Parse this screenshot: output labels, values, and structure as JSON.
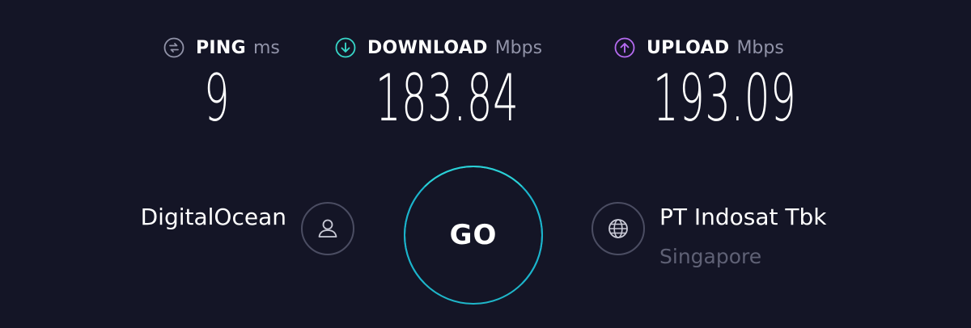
{
  "metrics": {
    "ping": {
      "label": "PING",
      "unit": "ms",
      "value": "9",
      "icon": "ping-icon",
      "color": "#9193a8"
    },
    "download": {
      "label": "DOWNLOAD",
      "unit": "Mbps",
      "value": "183.84",
      "icon": "download-arrow-icon",
      "color": "#37d6c8"
    },
    "upload": {
      "label": "UPLOAD",
      "unit": "Mbps",
      "value": "193.09",
      "icon": "upload-arrow-icon",
      "color": "#b56bf0"
    }
  },
  "provider": {
    "name": "DigitalOcean",
    "icon": "user-icon"
  },
  "go_button": {
    "label": "GO",
    "ring_color": "#1fb6c9"
  },
  "server": {
    "name": "PT Indosat Tbk",
    "location": "Singapore",
    "icon": "globe-icon"
  },
  "colors": {
    "background": "#141526",
    "text": "#ffffff",
    "muted": "#9193a8",
    "dim": "#5f6175"
  }
}
